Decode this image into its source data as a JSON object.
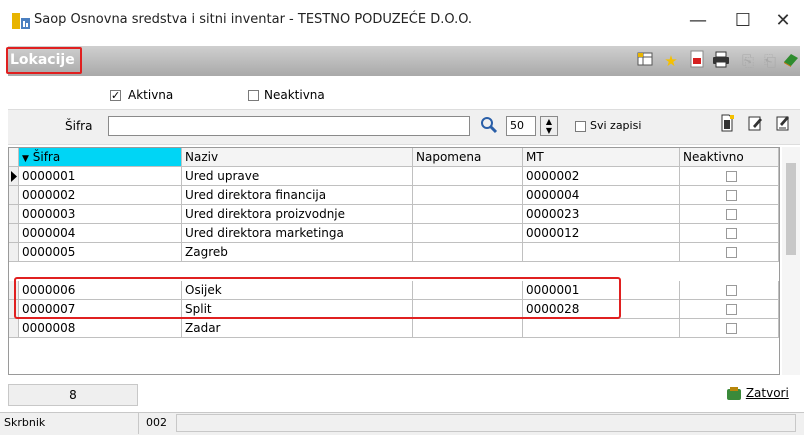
{
  "window": {
    "title": "Saop Osnovna sredstva i sitni inventar - TESTNO PODUZEĆE D.O.O.",
    "minimize": "—",
    "maximize": "☐",
    "close": "✕"
  },
  "header": {
    "title": "Lokacije",
    "toolbar_icons": [
      "grid-icon",
      "star-icon",
      "pdf-icon",
      "print-icon",
      "copy-icon",
      "paste-icon",
      "book-icon"
    ],
    "highlight_color": "#e02020"
  },
  "filters": {
    "active_label": "Aktivna",
    "active_checked": true,
    "inactive_label": "Neaktivna",
    "inactive_checked": false
  },
  "search": {
    "label": "Šifra",
    "value": "",
    "page_size": "50",
    "all_records_label": "Svi zapisi"
  },
  "table": {
    "columns": [
      "Šifra",
      "Naziv",
      "Napomena",
      "MT",
      "Neaktivno"
    ],
    "sort_arrow": "▼",
    "sorted_color": "#00d5f5",
    "rows": [
      {
        "sifra": "0000001",
        "naziv": "Ured uprave",
        "napomena": "",
        "mt": "0000002",
        "current": true
      },
      {
        "sifra": "0000002",
        "naziv": "Ured direktora financija",
        "napomena": "",
        "mt": "0000004"
      },
      {
        "sifra": "0000003",
        "naziv": "Ured direktora proizvodnje",
        "napomena": "",
        "mt": "0000023"
      },
      {
        "sifra": "0000004",
        "naziv": "Ured direktora marketinga",
        "napomena": "",
        "mt": "0000012"
      },
      {
        "sifra": "0000005",
        "naziv": "Zagreb",
        "napomena": "",
        "mt": ""
      },
      {
        "sifra": "0000006",
        "naziv": "Osijek",
        "napomena": "",
        "mt": "0000001"
      },
      {
        "sifra": "0000007",
        "naziv": "Split",
        "napomena": "",
        "mt": "0000028"
      },
      {
        "sifra": "0000008",
        "naziv": "Zadar",
        "napomena": "",
        "mt": ""
      }
    ]
  },
  "footer": {
    "record_count": "8",
    "close_label": "Zatvori"
  },
  "status": {
    "user_label": "Skrbnik",
    "user_code": "002"
  }
}
